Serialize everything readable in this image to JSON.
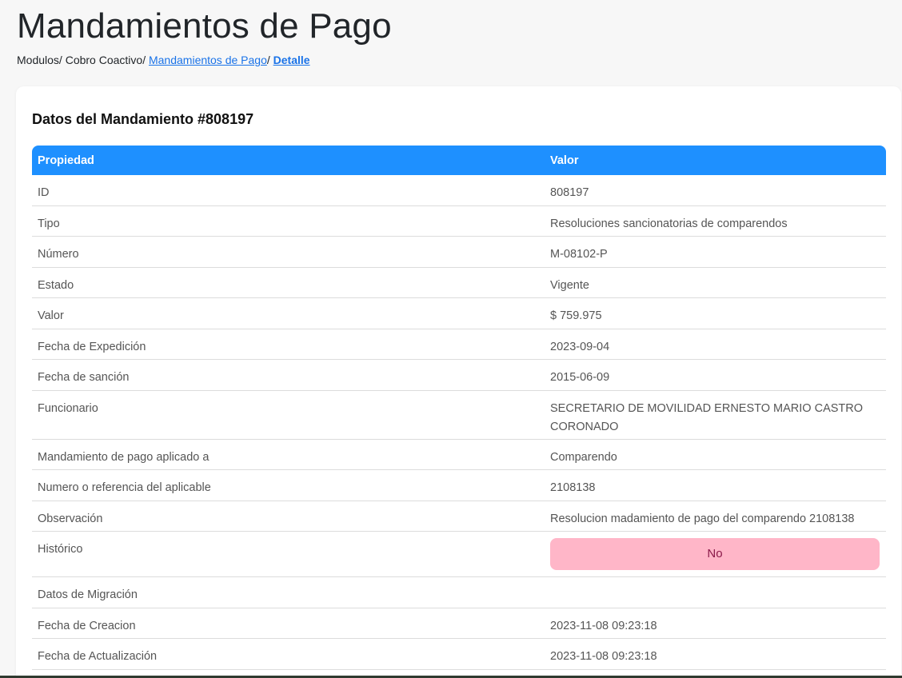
{
  "page": {
    "title": "Mandamientos de Pago"
  },
  "breadcrumb": {
    "item1": "Modulos",
    "sep": "/ ",
    "item2": "Cobro Coactivo",
    "item3": "Mandamientos de Pago",
    "item4": "Detalle"
  },
  "card": {
    "title": "Datos del Mandamiento #808197"
  },
  "table": {
    "headers": [
      "Propiedad",
      "Valor"
    ],
    "rows": [
      {
        "prop": "ID",
        "value": "808197"
      },
      {
        "prop": "Tipo",
        "value": "Resoluciones sancionatorias de comparendos"
      },
      {
        "prop": "Número",
        "value": "M-08102-P"
      },
      {
        "prop": "Estado",
        "value": "Vigente"
      },
      {
        "prop": "Valor",
        "value": "$ 759.975"
      },
      {
        "prop": "Fecha de Expedición",
        "value": "2023-09-04"
      },
      {
        "prop": "Fecha de sanción",
        "value": "2015-06-09"
      },
      {
        "prop": "Funcionario",
        "value": "SECRETARIO DE MOVILIDAD ERNESTO MARIO CASTRO CORONADO"
      },
      {
        "prop": "Mandamiento de pago aplicado a",
        "value": "Comparendo"
      },
      {
        "prop": "Numero o referencia del aplicable",
        "value": "2108138"
      },
      {
        "prop": "Observación",
        "value": "Resolucion madamiento de pago del comparendo 2108138"
      },
      {
        "prop": "Histórico",
        "value": "No"
      },
      {
        "prop": "Datos de Migración",
        "value": ""
      },
      {
        "prop": "Fecha de Creacion",
        "value": "2023-11-08 09:23:18"
      },
      {
        "prop": "Fecha de Actualización",
        "value": "2023-11-08 09:23:18"
      }
    ]
  },
  "colors": {
    "header_bg": "#1e90ff",
    "badge_bg": "#ffb6c8",
    "badge_text": "#8b1a4a",
    "link": "#1a73e8"
  }
}
